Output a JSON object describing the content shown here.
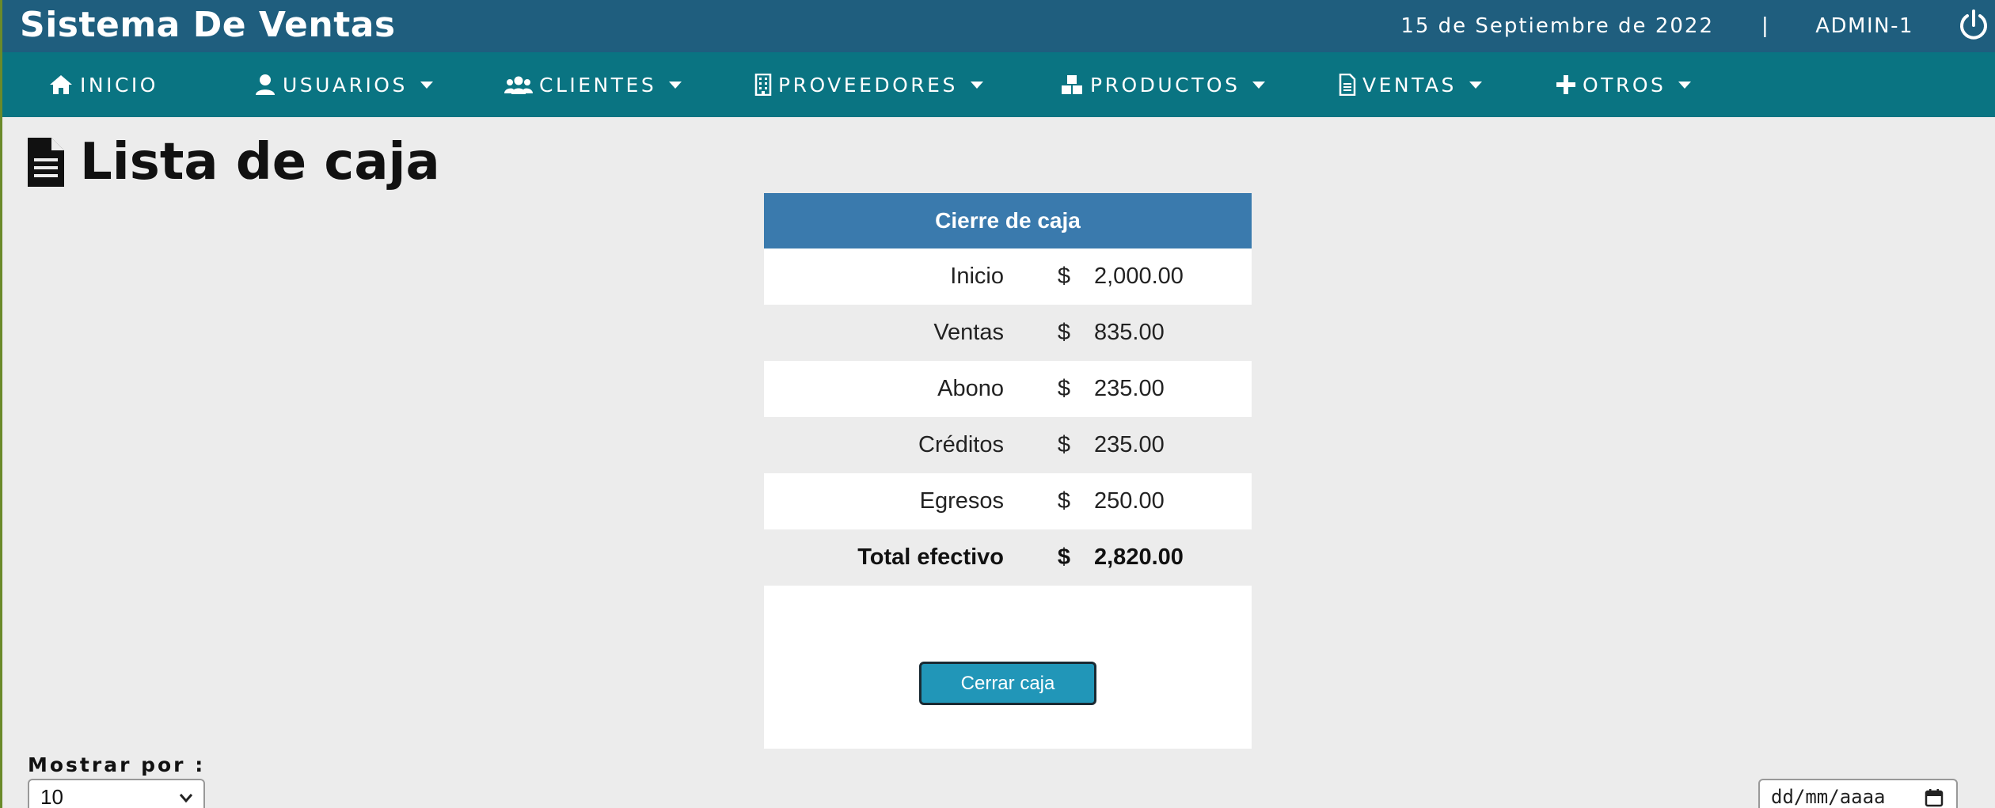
{
  "header": {
    "app_title": "Sistema De Ventas",
    "date": "15 de Septiembre de 2022",
    "separator": "|",
    "user": "ADMIN-1"
  },
  "nav": {
    "items": [
      {
        "label": "INICIO",
        "icon": "home-icon",
        "has_dropdown": false
      },
      {
        "label": "USUARIOS",
        "icon": "user-icon",
        "has_dropdown": true
      },
      {
        "label": "CLIENTES",
        "icon": "users-icon",
        "has_dropdown": true
      },
      {
        "label": "PROVEEDORES",
        "icon": "building-icon",
        "has_dropdown": true
      },
      {
        "label": "PRODUCTOS",
        "icon": "cubes-icon",
        "has_dropdown": true
      },
      {
        "label": "VENTAS",
        "icon": "file-icon",
        "has_dropdown": true
      },
      {
        "label": "OTROS",
        "icon": "plus-icon",
        "has_dropdown": true
      }
    ]
  },
  "page": {
    "title": "Lista de caja"
  },
  "cash_close": {
    "header": "Cierre de caja",
    "rows": [
      {
        "label": "Inicio",
        "currency": "$",
        "amount": "2,000.00"
      },
      {
        "label": "Ventas",
        "currency": "$",
        "amount": "835.00"
      },
      {
        "label": "Abono",
        "currency": "$",
        "amount": "235.00"
      },
      {
        "label": "Créditos",
        "currency": "$",
        "amount": "235.00"
      },
      {
        "label": "Egresos",
        "currency": "$",
        "amount": "250.00"
      }
    ],
    "total": {
      "label": "Total efectivo",
      "currency": "$",
      "amount": "2,820.00"
    },
    "button_label": "Cerrar caja"
  },
  "list_controls": {
    "show_label": "Mostrar por :",
    "page_size": "10",
    "date_placeholder": "dd/mm/aaaa"
  },
  "colors": {
    "header_bg": "#1f5e7e",
    "nav_bg": "#0a7482",
    "card_header_bg": "#3a7aad",
    "button_bg": "#2196b8"
  }
}
